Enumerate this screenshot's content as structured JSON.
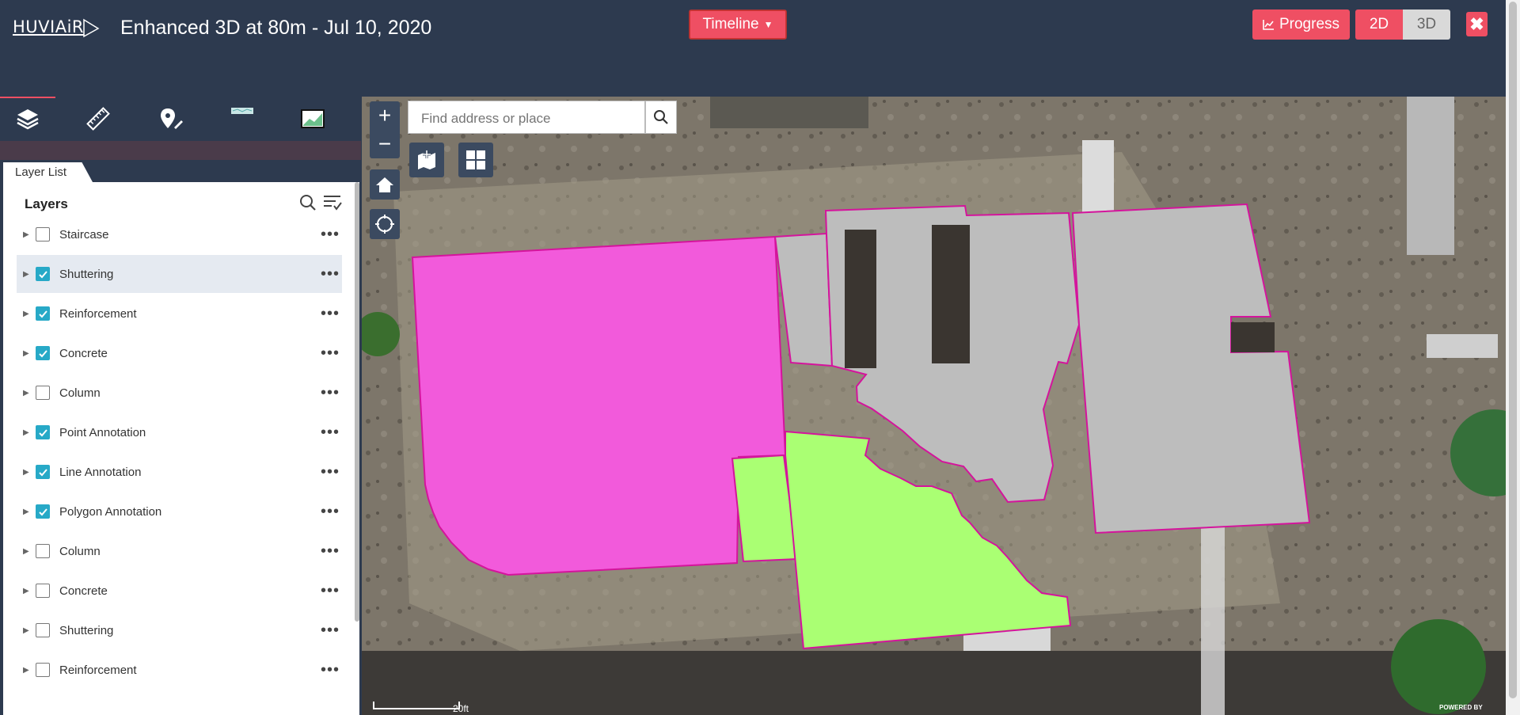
{
  "header": {
    "logo": "HUVIAiR",
    "title": "Enhanced 3D at 80m - Jul 10, 2020",
    "timeline_label": "Timeline",
    "progress_label": "Progress",
    "view_2d": "2D",
    "view_3d": "3D",
    "close": "✖"
  },
  "panel": {
    "tab_label": "Layer List",
    "heading": "Layers",
    "layers": [
      {
        "label": "Staircase",
        "checked": false
      },
      {
        "label": "Shuttering",
        "checked": true
      },
      {
        "label": "Reinforcement",
        "checked": true
      },
      {
        "label": "Concrete",
        "checked": true
      },
      {
        "label": "Column",
        "checked": false
      },
      {
        "label": "Point Annotation",
        "checked": true
      },
      {
        "label": "Line Annotation",
        "checked": true
      },
      {
        "label": "Polygon Annotation",
        "checked": true
      },
      {
        "label": "Column",
        "checked": false
      },
      {
        "label": "Concrete",
        "checked": false
      },
      {
        "label": "Shuttering",
        "checked": false
      },
      {
        "label": "Reinforcement",
        "checked": false
      }
    ]
  },
  "map": {
    "search_placeholder": "Find address or place",
    "zoom_in": "+",
    "zoom_out": "−",
    "scale_label": "20ft",
    "powered_by": "POWERED BY",
    "colors": {
      "shuttering": "#f25adb",
      "reinforcement": "#aaff73",
      "concrete": "#bdbdbd",
      "outline": "#d4149c"
    }
  },
  "colors": {
    "accent": "#ef4f63",
    "header_bg": "#2d3a4f",
    "checkbox": "#27a9c7"
  }
}
